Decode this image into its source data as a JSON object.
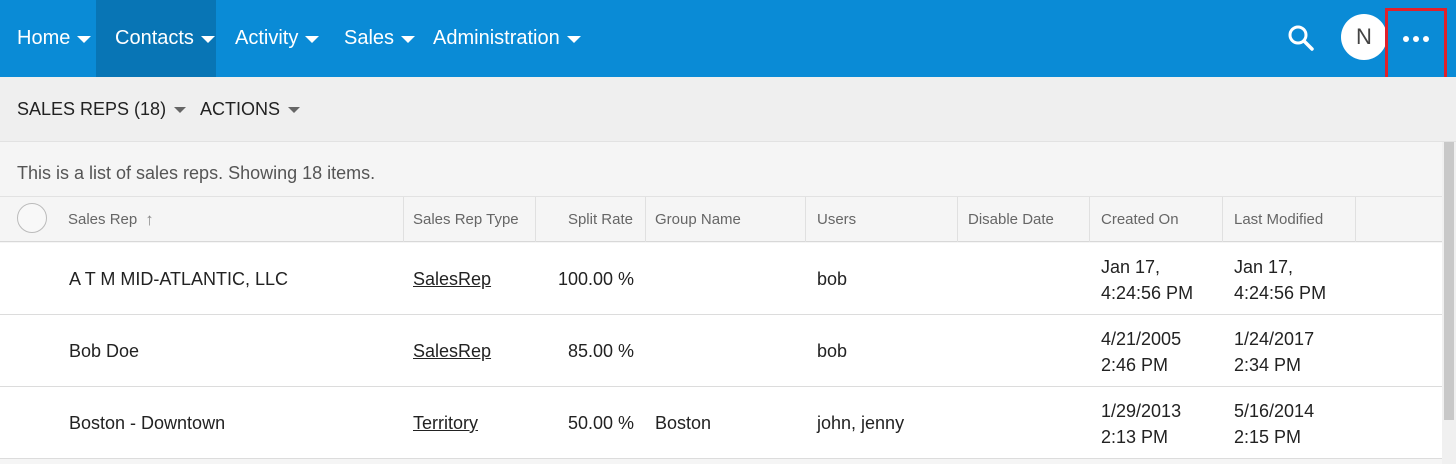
{
  "nav": {
    "items": [
      {
        "label": "Home",
        "active": false
      },
      {
        "label": "Contacts",
        "active": true
      },
      {
        "label": "Activity",
        "active": false
      },
      {
        "label": "Sales",
        "active": false
      },
      {
        "label": "Administration",
        "active": false
      }
    ],
    "avatar_initial": "N",
    "brand_color": "#0a8bd6",
    "active_color": "#0875b5",
    "highlight_color": "#e0202a"
  },
  "subheader": {
    "list_label": "SALES REPS (18)",
    "actions_label": "ACTIONS"
  },
  "caption": "This is a list of sales reps. Showing 18 items.",
  "table": {
    "columns": [
      "Sales Rep",
      "Sales Rep Type",
      "Split Rate",
      "Group Name",
      "Users",
      "Disable Date",
      "Created On",
      "Last Modified"
    ],
    "sort_indicator": "↑",
    "rows": [
      {
        "sales_rep": "A T M MID-ATLANTIC, LLC",
        "type": "SalesRep",
        "split_rate": "100.00 %",
        "group_name": "",
        "users": "bob",
        "disable_date": "",
        "created_on": [
          "Jan 17,",
          "4:24:56 PM"
        ],
        "last_modified": [
          "Jan 17,",
          "4:24:56 PM"
        ]
      },
      {
        "sales_rep": "Bob Doe",
        "type": "SalesRep",
        "split_rate": "85.00 %",
        "group_name": "",
        "users": "bob",
        "disable_date": "",
        "created_on": [
          "4/21/2005",
          "2:46 PM"
        ],
        "last_modified": [
          "1/24/2017",
          "2:34 PM"
        ]
      },
      {
        "sales_rep": "Boston - Downtown",
        "type": "Territory",
        "split_rate": "50.00 %",
        "group_name": "Boston",
        "users": "john, jenny",
        "disable_date": "",
        "created_on": [
          "1/29/2013",
          "2:13 PM"
        ],
        "last_modified": [
          "5/16/2014",
          "2:15 PM"
        ]
      }
    ]
  }
}
